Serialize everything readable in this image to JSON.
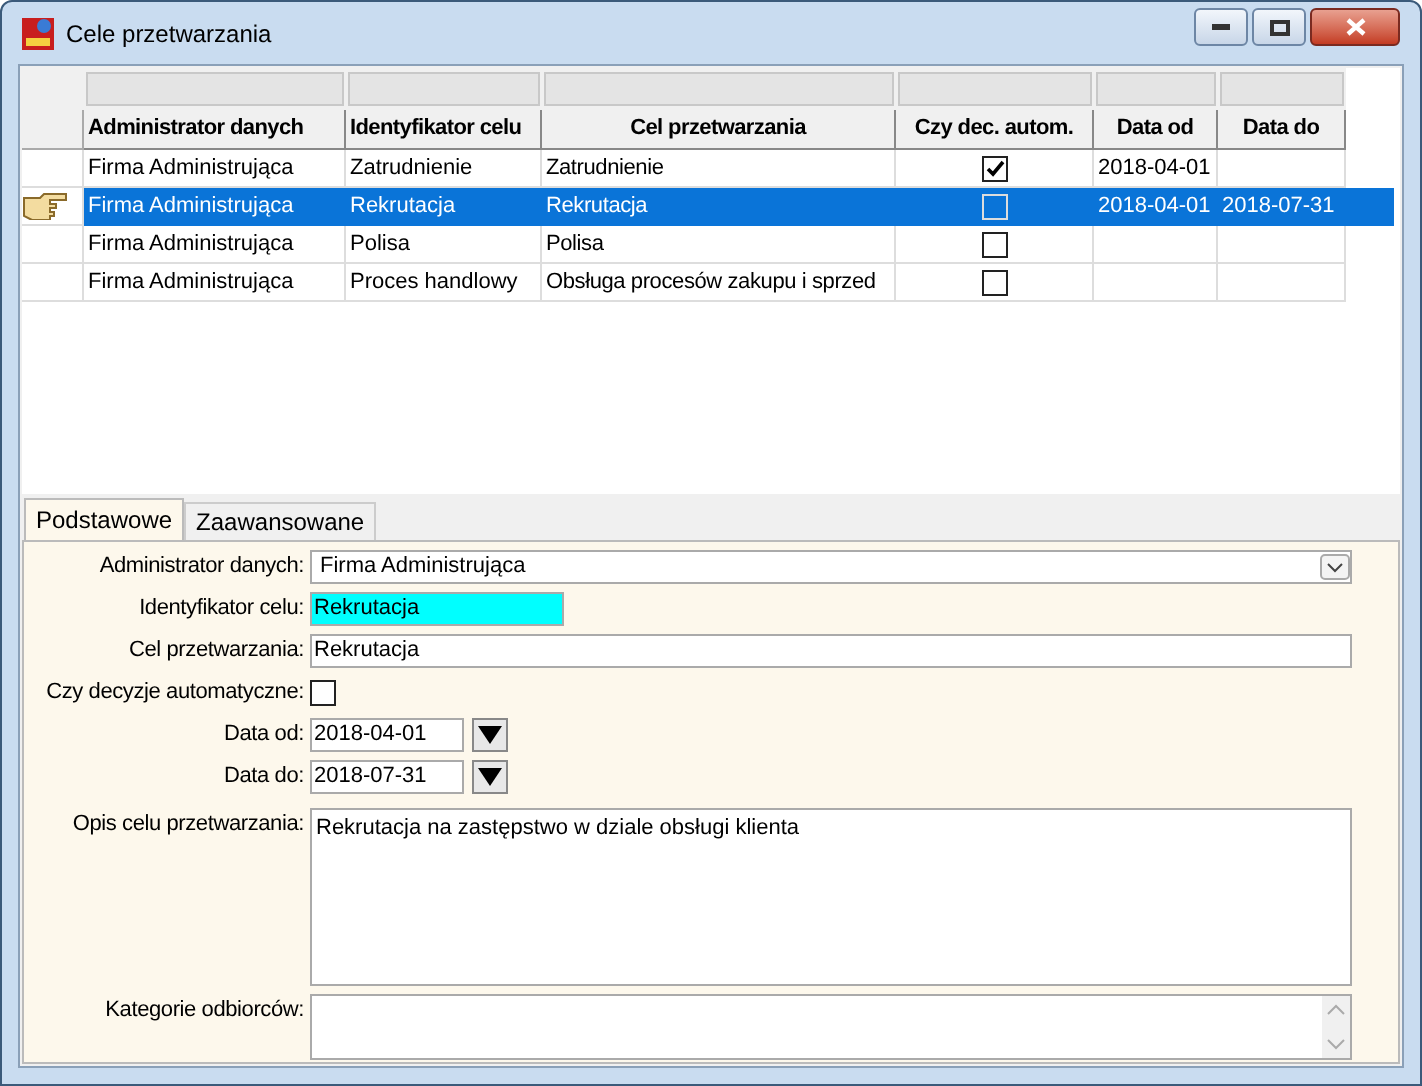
{
  "window": {
    "title": "Cele przetwarzania"
  },
  "table": {
    "columns": [
      "Administrator danych",
      "Identyfikator celu",
      "Cel przetwarzania",
      "Czy dec. autom.",
      "Data od",
      "Data do"
    ],
    "rows": [
      {
        "administrator": "Firma Administrująca",
        "identyfikator": "Zatrudnienie",
        "cel": "Zatrudnienie",
        "auto": true,
        "data_od": "2018-04-01",
        "data_do": "",
        "selected": false
      },
      {
        "administrator": "Firma Administrująca",
        "identyfikator": "Rekrutacja",
        "cel": "Rekrutacja",
        "auto": false,
        "data_od": "2018-04-01",
        "data_do": "2018-07-31",
        "selected": true
      },
      {
        "administrator": "Firma Administrująca",
        "identyfikator": "Polisa",
        "cel": "Polisa",
        "auto": false,
        "data_od": "",
        "data_do": "",
        "selected": false
      },
      {
        "administrator": "Firma Administrująca",
        "identyfikator": "Proces handlowy",
        "cel": "Obsługa procesów zakupu i sprzed",
        "auto": false,
        "data_od": "",
        "data_do": "",
        "selected": false
      }
    ]
  },
  "tabs": [
    {
      "label": "Podstawowe",
      "selected": true
    },
    {
      "label": "Zaawansowane",
      "selected": false
    }
  ],
  "form": {
    "administrator": {
      "label": "Administrator danych:",
      "value": "Firma Administrująca"
    },
    "identyfikator": {
      "label": "Identyfikator celu:",
      "value": "Rekrutacja"
    },
    "cel": {
      "label": "Cel przetwarzania:",
      "value": "Rekrutacja"
    },
    "auto": {
      "label": "Czy decyzje automatyczne:",
      "checked": false
    },
    "data_od": {
      "label": "Data od:",
      "value": "2018-04-01"
    },
    "data_do": {
      "label": "Data do:",
      "value": "2018-07-31"
    },
    "opis": {
      "label": "Opis celu przetwarzania:",
      "value": "Rekrutacja na zastępstwo w dziale obsługi klienta"
    },
    "kategorie": {
      "label": "Kategorie odbiorców:"
    }
  }
}
